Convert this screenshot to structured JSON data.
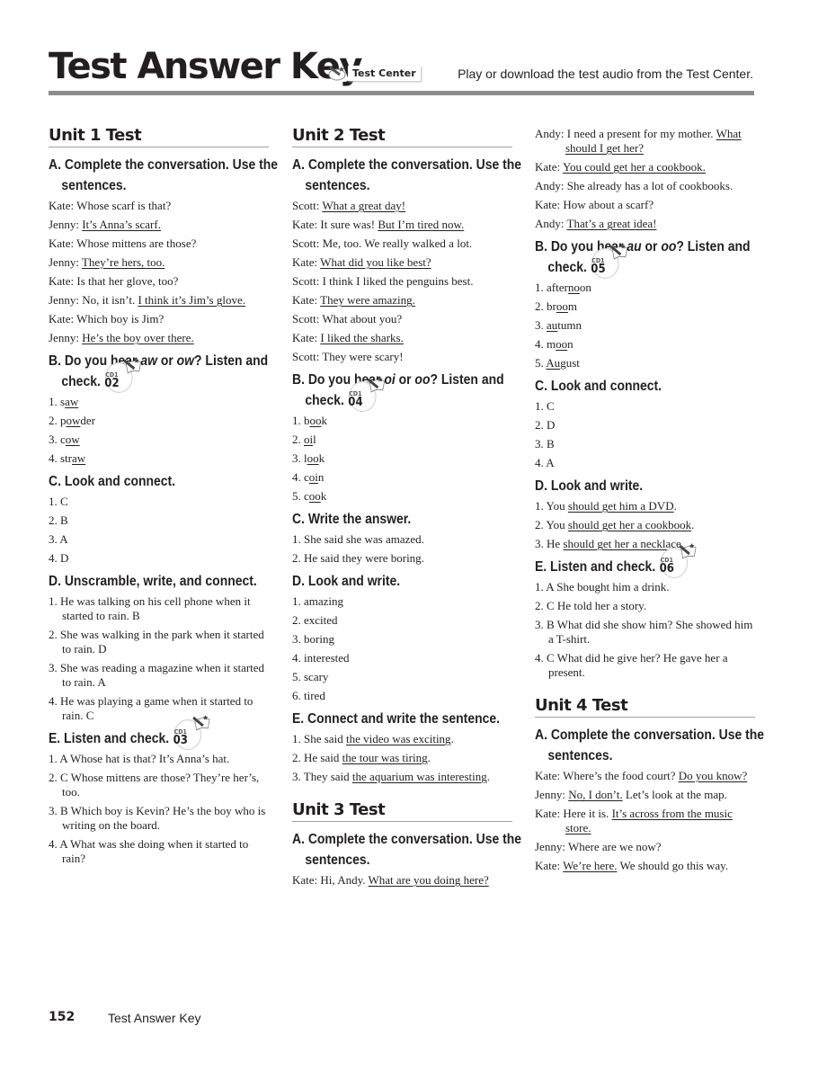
{
  "header": {
    "title": "Test Answer Key",
    "test_center_label": "Test Center",
    "note": "Play or download the test audio from the Test Center."
  },
  "footer": {
    "page_number": "152",
    "label": "Test Answer Key"
  },
  "unit1": {
    "title": "Unit 1 Test",
    "A": {
      "heading": "A. Complete the conversation. Use the sentences.",
      "lines": [
        {
          "speaker": "Kate:",
          "parts": [
            {
              "t": "Whose scarf is that?"
            }
          ]
        },
        {
          "speaker": "Jenny:",
          "parts": [
            {
              "t": "It’s Anna’s scarf.",
              "u": true
            }
          ]
        },
        {
          "speaker": "Kate:",
          "parts": [
            {
              "t": "Whose mittens are those?"
            }
          ]
        },
        {
          "speaker": "Jenny:",
          "parts": [
            {
              "t": "They’re hers, too.",
              "u": true
            }
          ]
        },
        {
          "speaker": "Kate:",
          "parts": [
            {
              "t": "Is that her glove, too?"
            }
          ]
        },
        {
          "speaker": "Jenny:",
          "parts": [
            {
              "t": "No, it isn’t. "
            },
            {
              "t": "I think it’s Jim’s glove.",
              "u": true
            }
          ]
        },
        {
          "speaker": "Kate:",
          "parts": [
            {
              "t": "Which boy is Jim?"
            }
          ]
        },
        {
          "speaker": "Jenny:",
          "parts": [
            {
              "t": "He’s the boy over there.",
              "u": true
            }
          ]
        }
      ]
    },
    "B": {
      "heading_pre": "B. Do you hear ",
      "em1": "aw",
      "mid": " or ",
      "em2": "ow",
      "post": "? Listen and check.",
      "cd": {
        "disc": "CD1",
        "track": "02"
      },
      "items": [
        {
          "n": "1.",
          "parts": [
            {
              "t": "s"
            },
            {
              "t": "aw",
              "u": true
            }
          ]
        },
        {
          "n": "2.",
          "parts": [
            {
              "t": "p"
            },
            {
              "t": "ow",
              "u": true
            },
            {
              "t": "der"
            }
          ]
        },
        {
          "n": "3.",
          "parts": [
            {
              "t": "c"
            },
            {
              "t": "ow",
              "u": true
            }
          ]
        },
        {
          "n": "4.",
          "parts": [
            {
              "t": "str"
            },
            {
              "t": "aw",
              "u": true
            }
          ]
        }
      ]
    },
    "C": {
      "heading": "C. Look and connect.",
      "items": [
        {
          "n": "1.",
          "t": "C"
        },
        {
          "n": "2.",
          "t": "B"
        },
        {
          "n": "3.",
          "t": "A"
        },
        {
          "n": "4.",
          "t": "D"
        }
      ]
    },
    "D": {
      "heading": "D. Unscramble, write, and connect.",
      "items": [
        {
          "n": "1.",
          "t": "He was talking on his cell phone when it started to rain. B"
        },
        {
          "n": "2.",
          "t": "She was walking in the park when it started to rain. D"
        },
        {
          "n": "3.",
          "t": "She was reading a magazine when it started to rain. A"
        },
        {
          "n": "4.",
          "t": "He was playing a game when it started to rain. C"
        }
      ]
    },
    "E": {
      "heading": "E. Listen and check.",
      "cd": {
        "disc": "CD1",
        "track": "03"
      },
      "items": [
        {
          "n": "1.",
          "t": "A Whose hat is that? It’s Anna’s hat."
        },
        {
          "n": "2.",
          "t": "C Whose mittens are those? They’re her’s, too."
        },
        {
          "n": "3.",
          "t": "B Which boy is Kevin? He’s the boy who is writing on the board."
        },
        {
          "n": "4.",
          "t": "A What was she doing when it started to rain?"
        }
      ]
    }
  },
  "unit2": {
    "title": "Unit 2 Test",
    "A": {
      "heading": "A. Complete the conversation. Use the sentences.",
      "lines": [
        {
          "speaker": "Scott:",
          "parts": [
            {
              "t": "What a great day!",
              "u": true
            }
          ]
        },
        {
          "speaker": "Kate:",
          "parts": [
            {
              "t": "It sure was! "
            },
            {
              "t": "But I’m tired now.",
              "u": true
            }
          ]
        },
        {
          "speaker": "Scott:",
          "parts": [
            {
              "t": "Me, too. We really walked a lot."
            }
          ]
        },
        {
          "speaker": "Kate:",
          "parts": [
            {
              "t": "What did you like best?",
              "u": true
            }
          ]
        },
        {
          "speaker": "Scott:",
          "parts": [
            {
              "t": "I think I liked the penguins best."
            }
          ]
        },
        {
          "speaker": "Kate:",
          "parts": [
            {
              "t": "They were amazing.",
              "u": true
            }
          ]
        },
        {
          "speaker": "Scott:",
          "parts": [
            {
              "t": "What about you?"
            }
          ]
        },
        {
          "speaker": "Kate:",
          "parts": [
            {
              "t": "I liked the sharks.",
              "u": true
            }
          ]
        },
        {
          "speaker": "Scott:",
          "parts": [
            {
              "t": "They were scary!"
            }
          ]
        }
      ]
    },
    "B": {
      "heading_pre": "B. Do you hear ",
      "em1": "oi",
      "mid": " or ",
      "em2": "oo",
      "post": "? Listen and check.",
      "cd": {
        "disc": "CD1",
        "track": "04"
      },
      "items": [
        {
          "n": "1.",
          "parts": [
            {
              "t": "b"
            },
            {
              "t": "oo",
              "u": true
            },
            {
              "t": "k"
            }
          ]
        },
        {
          "n": "2.",
          "parts": [
            {
              "t": "oi",
              "u": true
            },
            {
              "t": "l"
            }
          ]
        },
        {
          "n": "3.",
          "parts": [
            {
              "t": "l"
            },
            {
              "t": "oo",
              "u": true
            },
            {
              "t": "k"
            }
          ]
        },
        {
          "n": "4.",
          "parts": [
            {
              "t": "c"
            },
            {
              "t": "oi",
              "u": true
            },
            {
              "t": "n"
            }
          ]
        },
        {
          "n": "5.",
          "parts": [
            {
              "t": "c"
            },
            {
              "t": "oo",
              "u": true
            },
            {
              "t": "k"
            }
          ]
        }
      ]
    },
    "C": {
      "heading": "C. Write the answer.",
      "items": [
        {
          "n": "1.",
          "t": "She said she was amazed."
        },
        {
          "n": "2.",
          "t": "He said they were boring."
        }
      ]
    },
    "D": {
      "heading": "D. Look and write.",
      "items": [
        {
          "n": "1.",
          "t": "amazing"
        },
        {
          "n": "2.",
          "t": "excited"
        },
        {
          "n": "3.",
          "t": "boring"
        },
        {
          "n": "4.",
          "t": "interested"
        },
        {
          "n": "5.",
          "t": "scary"
        },
        {
          "n": "6.",
          "t": "tired"
        }
      ]
    },
    "E": {
      "heading": "E. Connect and write the sentence.",
      "items": [
        {
          "n": "1.",
          "parts": [
            {
              "t": "She said "
            },
            {
              "t": "the video was exciting",
              "u": true
            },
            {
              "t": "."
            }
          ]
        },
        {
          "n": "2.",
          "parts": [
            {
              "t": "He said "
            },
            {
              "t": "the tour was tiring",
              "u": true
            },
            {
              "t": "."
            }
          ]
        },
        {
          "n": "3.",
          "parts": [
            {
              "t": "They said "
            },
            {
              "t": "the aquarium was interesting",
              "u": true
            },
            {
              "t": "."
            }
          ]
        }
      ]
    }
  },
  "unit3": {
    "title": "Unit 3 Test",
    "A": {
      "heading": "A. Complete the conversation. Use the sentences.",
      "lines": [
        {
          "speaker": "Kate:",
          "parts": [
            {
              "t": "Hi, Andy. "
            },
            {
              "t": "What are you doing here?",
              "u": true
            }
          ]
        },
        {
          "speaker": "Andy:",
          "parts": [
            {
              "t": "I need a present for my mother. "
            },
            {
              "t": "What should I get her?",
              "u": true
            }
          ]
        },
        {
          "speaker": "Kate:",
          "parts": [
            {
              "t": "You could get her a cookbook.",
              "u": true
            }
          ]
        },
        {
          "speaker": "Andy:",
          "parts": [
            {
              "t": "She already has a lot of cookbooks."
            }
          ]
        },
        {
          "speaker": "Kate:",
          "parts": [
            {
              "t": "How about a scarf?"
            }
          ]
        },
        {
          "speaker": "Andy:",
          "parts": [
            {
              "t": "That’s a great idea!",
              "u": true
            }
          ]
        }
      ]
    },
    "B": {
      "heading_pre": "B. Do you hear ",
      "em1": "au",
      "mid": " or ",
      "em2": "oo",
      "post": "? Listen and check.",
      "cd": {
        "disc": "CD1",
        "track": "05"
      },
      "items": [
        {
          "n": "1.",
          "parts": [
            {
              "t": "after"
            },
            {
              "t": "no",
              "u": true
            },
            {
              "t": "on"
            }
          ]
        },
        {
          "n": "2.",
          "parts": [
            {
              "t": "br"
            },
            {
              "t": "oo",
              "u": true
            },
            {
              "t": "m"
            }
          ]
        },
        {
          "n": "3.",
          "parts": [
            {
              "t": "au",
              "u": true
            },
            {
              "t": "tumn"
            }
          ]
        },
        {
          "n": "4.",
          "parts": [
            {
              "t": "m"
            },
            {
              "t": "oo",
              "u": true
            },
            {
              "t": "n"
            }
          ]
        },
        {
          "n": "5.",
          "parts": [
            {
              "t": "Au",
              "u": true
            },
            {
              "t": "gust"
            }
          ]
        }
      ]
    },
    "C": {
      "heading": "C. Look and connect.",
      "items": [
        {
          "n": "1.",
          "t": "C"
        },
        {
          "n": "2.",
          "t": "D"
        },
        {
          "n": "3.",
          "t": "B"
        },
        {
          "n": "4.",
          "t": "A"
        }
      ]
    },
    "D": {
      "heading": "D. Look and write.",
      "items": [
        {
          "n": "1.",
          "parts": [
            {
              "t": "You "
            },
            {
              "t": "should get him a DVD",
              "u": true
            },
            {
              "t": "."
            }
          ]
        },
        {
          "n": "2.",
          "parts": [
            {
              "t": "You "
            },
            {
              "t": "should get her a cookbook",
              "u": true
            },
            {
              "t": "."
            }
          ]
        },
        {
          "n": "3.",
          "parts": [
            {
              "t": "He "
            },
            {
              "t": "should get her a necklace",
              "u": true
            },
            {
              "t": "."
            }
          ]
        }
      ]
    },
    "E": {
      "heading": "E. Listen and check.",
      "cd": {
        "disc": "CD1",
        "track": "06"
      },
      "items": [
        {
          "n": "1.",
          "t": "A She bought him a drink."
        },
        {
          "n": "2.",
          "t": "C He told her a story."
        },
        {
          "n": "3.",
          "t": "B What did she show him? She showed him a T-shirt."
        },
        {
          "n": "4.",
          "t": "C What did he give her? He gave her a present."
        }
      ]
    }
  },
  "unit4": {
    "title": "Unit 4 Test",
    "A": {
      "heading": "A. Complete the conversation. Use the sentences.",
      "lines": [
        {
          "speaker": "Kate:",
          "parts": [
            {
              "t": "Where’s the food court? "
            },
            {
              "t": "Do you know?",
              "u": true
            }
          ]
        },
        {
          "speaker": "Jenny:",
          "parts": [
            {
              "t": "No, I don’t.",
              "u": true
            },
            {
              "t": " Let’s look at the map."
            }
          ]
        },
        {
          "speaker": "Kate:",
          "parts": [
            {
              "t": "Here it is. "
            },
            {
              "t": "It’s across from the music store.",
              "u": true
            }
          ]
        },
        {
          "speaker": "Jenny:",
          "parts": [
            {
              "t": "Where are we now?"
            }
          ]
        },
        {
          "speaker": "Kate:",
          "parts": [
            {
              "t": "We’re here.",
              "u": true
            },
            {
              "t": " We should go this way."
            }
          ]
        }
      ]
    }
  }
}
